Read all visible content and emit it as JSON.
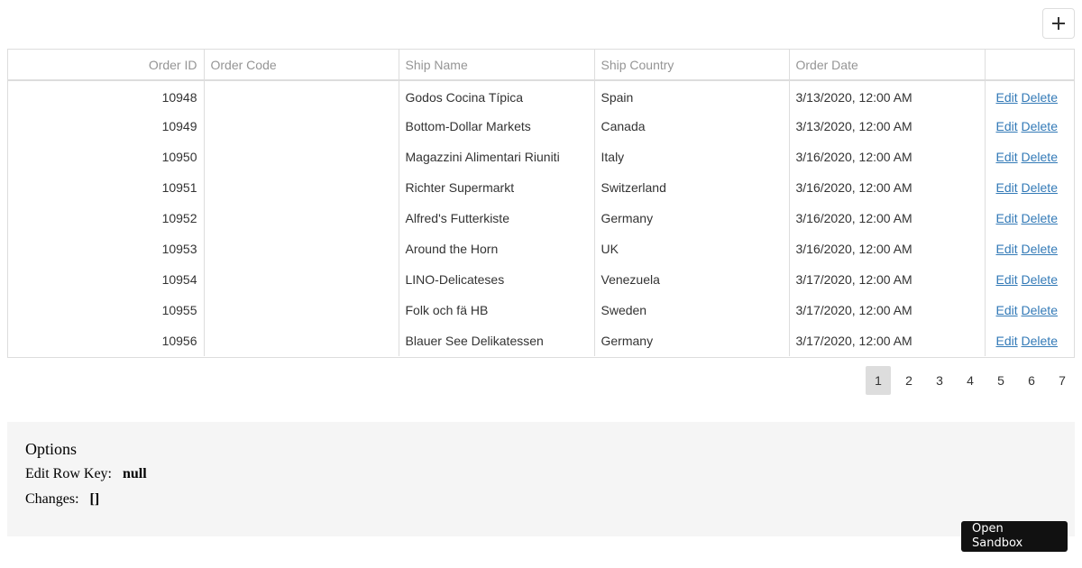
{
  "toolbar": {
    "add_icon": "plus-icon"
  },
  "grid": {
    "columns": [
      "Order ID",
      "Order Code",
      "Ship Name",
      "Ship Country",
      "Order Date",
      ""
    ],
    "edit_label": "Edit",
    "delete_label": "Delete",
    "rows": [
      {
        "id": "10948",
        "code": "",
        "ship_name": "Godos Cocina Típica",
        "country": "Spain",
        "date": "3/13/2020, 12:00 AM"
      },
      {
        "id": "10949",
        "code": "",
        "ship_name": "Bottom-Dollar Markets",
        "country": "Canada",
        "date": "3/13/2020, 12:00 AM"
      },
      {
        "id": "10950",
        "code": "",
        "ship_name": "Magazzini Alimentari Riuniti",
        "country": "Italy",
        "date": "3/16/2020, 12:00 AM"
      },
      {
        "id": "10951",
        "code": "",
        "ship_name": "Richter Supermarkt",
        "country": "Switzerland",
        "date": "3/16/2020, 12:00 AM"
      },
      {
        "id": "10952",
        "code": "",
        "ship_name": "Alfred's Futterkiste",
        "country": "Germany",
        "date": "3/16/2020, 12:00 AM"
      },
      {
        "id": "10953",
        "code": "",
        "ship_name": "Around the Horn",
        "country": "UK",
        "date": "3/16/2020, 12:00 AM"
      },
      {
        "id": "10954",
        "code": "",
        "ship_name": "LINO-Delicateses",
        "country": "Venezuela",
        "date": "3/17/2020, 12:00 AM"
      },
      {
        "id": "10955",
        "code": "",
        "ship_name": "Folk och fä HB",
        "country": "Sweden",
        "date": "3/17/2020, 12:00 AM"
      },
      {
        "id": "10956",
        "code": "",
        "ship_name": "Blauer See Delikatessen",
        "country": "Germany",
        "date": "3/17/2020, 12:00 AM"
      }
    ]
  },
  "pager": {
    "pages": [
      "1",
      "2",
      "3",
      "4",
      "5",
      "6",
      "7"
    ],
    "current": "1"
  },
  "options": {
    "title": "Options",
    "edit_row_key_label": "Edit Row Key:",
    "edit_row_key_value": "null",
    "changes_label": "Changes:",
    "changes_value": "[]"
  },
  "sandbox": {
    "label": "Open Sandbox"
  }
}
